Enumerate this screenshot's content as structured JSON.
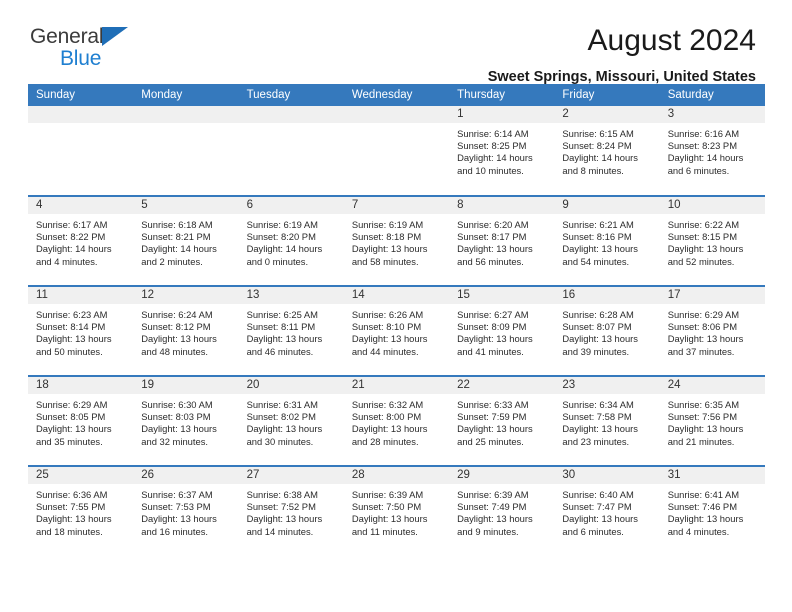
{
  "brand": {
    "name_top": "General",
    "name_bottom": "Blue",
    "color_dark": "#3b3b3b",
    "color_blue": "#1f7fd0",
    "triangle_color": "#1f6eb7"
  },
  "header": {
    "title": "August 2024",
    "subtitle": "Sweet Springs, Missouri, United States"
  },
  "theme": {
    "header_bar": "#3579bd",
    "daynum_bar": "#f0f0f0",
    "text": "#2b2b2b"
  },
  "weekdays": [
    "Sunday",
    "Monday",
    "Tuesday",
    "Wednesday",
    "Thursday",
    "Friday",
    "Saturday"
  ],
  "weeks": [
    [
      {
        "day": "",
        "sunrise": "",
        "sunset": "",
        "daylight": "",
        "daylight2": ""
      },
      {
        "day": "",
        "sunrise": "",
        "sunset": "",
        "daylight": "",
        "daylight2": ""
      },
      {
        "day": "",
        "sunrise": "",
        "sunset": "",
        "daylight": "",
        "daylight2": ""
      },
      {
        "day": "",
        "sunrise": "",
        "sunset": "",
        "daylight": "",
        "daylight2": ""
      },
      {
        "day": "1",
        "sunrise": "Sunrise: 6:14 AM",
        "sunset": "Sunset: 8:25 PM",
        "daylight": "Daylight: 14 hours",
        "daylight2": "and 10 minutes."
      },
      {
        "day": "2",
        "sunrise": "Sunrise: 6:15 AM",
        "sunset": "Sunset: 8:24 PM",
        "daylight": "Daylight: 14 hours",
        "daylight2": "and 8 minutes."
      },
      {
        "day": "3",
        "sunrise": "Sunrise: 6:16 AM",
        "sunset": "Sunset: 8:23 PM",
        "daylight": "Daylight: 14 hours",
        "daylight2": "and 6 minutes."
      }
    ],
    [
      {
        "day": "4",
        "sunrise": "Sunrise: 6:17 AM",
        "sunset": "Sunset: 8:22 PM",
        "daylight": "Daylight: 14 hours",
        "daylight2": "and 4 minutes."
      },
      {
        "day": "5",
        "sunrise": "Sunrise: 6:18 AM",
        "sunset": "Sunset: 8:21 PM",
        "daylight": "Daylight: 14 hours",
        "daylight2": "and 2 minutes."
      },
      {
        "day": "6",
        "sunrise": "Sunrise: 6:19 AM",
        "sunset": "Sunset: 8:20 PM",
        "daylight": "Daylight: 14 hours",
        "daylight2": "and 0 minutes."
      },
      {
        "day": "7",
        "sunrise": "Sunrise: 6:19 AM",
        "sunset": "Sunset: 8:18 PM",
        "daylight": "Daylight: 13 hours",
        "daylight2": "and 58 minutes."
      },
      {
        "day": "8",
        "sunrise": "Sunrise: 6:20 AM",
        "sunset": "Sunset: 8:17 PM",
        "daylight": "Daylight: 13 hours",
        "daylight2": "and 56 minutes."
      },
      {
        "day": "9",
        "sunrise": "Sunrise: 6:21 AM",
        "sunset": "Sunset: 8:16 PM",
        "daylight": "Daylight: 13 hours",
        "daylight2": "and 54 minutes."
      },
      {
        "day": "10",
        "sunrise": "Sunrise: 6:22 AM",
        "sunset": "Sunset: 8:15 PM",
        "daylight": "Daylight: 13 hours",
        "daylight2": "and 52 minutes."
      }
    ],
    [
      {
        "day": "11",
        "sunrise": "Sunrise: 6:23 AM",
        "sunset": "Sunset: 8:14 PM",
        "daylight": "Daylight: 13 hours",
        "daylight2": "and 50 minutes."
      },
      {
        "day": "12",
        "sunrise": "Sunrise: 6:24 AM",
        "sunset": "Sunset: 8:12 PM",
        "daylight": "Daylight: 13 hours",
        "daylight2": "and 48 minutes."
      },
      {
        "day": "13",
        "sunrise": "Sunrise: 6:25 AM",
        "sunset": "Sunset: 8:11 PM",
        "daylight": "Daylight: 13 hours",
        "daylight2": "and 46 minutes."
      },
      {
        "day": "14",
        "sunrise": "Sunrise: 6:26 AM",
        "sunset": "Sunset: 8:10 PM",
        "daylight": "Daylight: 13 hours",
        "daylight2": "and 44 minutes."
      },
      {
        "day": "15",
        "sunrise": "Sunrise: 6:27 AM",
        "sunset": "Sunset: 8:09 PM",
        "daylight": "Daylight: 13 hours",
        "daylight2": "and 41 minutes."
      },
      {
        "day": "16",
        "sunrise": "Sunrise: 6:28 AM",
        "sunset": "Sunset: 8:07 PM",
        "daylight": "Daylight: 13 hours",
        "daylight2": "and 39 minutes."
      },
      {
        "day": "17",
        "sunrise": "Sunrise: 6:29 AM",
        "sunset": "Sunset: 8:06 PM",
        "daylight": "Daylight: 13 hours",
        "daylight2": "and 37 minutes."
      }
    ],
    [
      {
        "day": "18",
        "sunrise": "Sunrise: 6:29 AM",
        "sunset": "Sunset: 8:05 PM",
        "daylight": "Daylight: 13 hours",
        "daylight2": "and 35 minutes."
      },
      {
        "day": "19",
        "sunrise": "Sunrise: 6:30 AM",
        "sunset": "Sunset: 8:03 PM",
        "daylight": "Daylight: 13 hours",
        "daylight2": "and 32 minutes."
      },
      {
        "day": "20",
        "sunrise": "Sunrise: 6:31 AM",
        "sunset": "Sunset: 8:02 PM",
        "daylight": "Daylight: 13 hours",
        "daylight2": "and 30 minutes."
      },
      {
        "day": "21",
        "sunrise": "Sunrise: 6:32 AM",
        "sunset": "Sunset: 8:00 PM",
        "daylight": "Daylight: 13 hours",
        "daylight2": "and 28 minutes."
      },
      {
        "day": "22",
        "sunrise": "Sunrise: 6:33 AM",
        "sunset": "Sunset: 7:59 PM",
        "daylight": "Daylight: 13 hours",
        "daylight2": "and 25 minutes."
      },
      {
        "day": "23",
        "sunrise": "Sunrise: 6:34 AM",
        "sunset": "Sunset: 7:58 PM",
        "daylight": "Daylight: 13 hours",
        "daylight2": "and 23 minutes."
      },
      {
        "day": "24",
        "sunrise": "Sunrise: 6:35 AM",
        "sunset": "Sunset: 7:56 PM",
        "daylight": "Daylight: 13 hours",
        "daylight2": "and 21 minutes."
      }
    ],
    [
      {
        "day": "25",
        "sunrise": "Sunrise: 6:36 AM",
        "sunset": "Sunset: 7:55 PM",
        "daylight": "Daylight: 13 hours",
        "daylight2": "and 18 minutes."
      },
      {
        "day": "26",
        "sunrise": "Sunrise: 6:37 AM",
        "sunset": "Sunset: 7:53 PM",
        "daylight": "Daylight: 13 hours",
        "daylight2": "and 16 minutes."
      },
      {
        "day": "27",
        "sunrise": "Sunrise: 6:38 AM",
        "sunset": "Sunset: 7:52 PM",
        "daylight": "Daylight: 13 hours",
        "daylight2": "and 14 minutes."
      },
      {
        "day": "28",
        "sunrise": "Sunrise: 6:39 AM",
        "sunset": "Sunset: 7:50 PM",
        "daylight": "Daylight: 13 hours",
        "daylight2": "and 11 minutes."
      },
      {
        "day": "29",
        "sunrise": "Sunrise: 6:39 AM",
        "sunset": "Sunset: 7:49 PM",
        "daylight": "Daylight: 13 hours",
        "daylight2": "and 9 minutes."
      },
      {
        "day": "30",
        "sunrise": "Sunrise: 6:40 AM",
        "sunset": "Sunset: 7:47 PM",
        "daylight": "Daylight: 13 hours",
        "daylight2": "and 6 minutes."
      },
      {
        "day": "31",
        "sunrise": "Sunrise: 6:41 AM",
        "sunset": "Sunset: 7:46 PM",
        "daylight": "Daylight: 13 hours",
        "daylight2": "and 4 minutes."
      }
    ]
  ]
}
